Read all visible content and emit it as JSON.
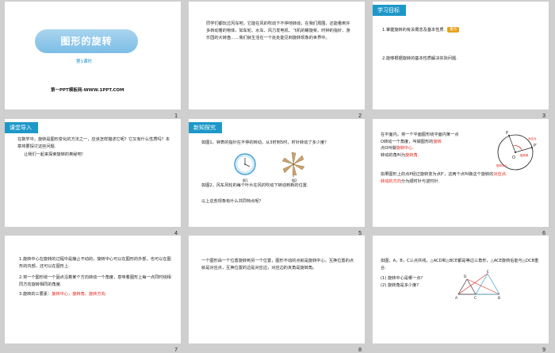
{
  "slides": [
    {
      "num": "1",
      "title": "图形的旋转",
      "subtitle": "第1课时",
      "brand": "第一PPT模板网-WWW.1PPT.COM"
    },
    {
      "num": "2",
      "text": "同学们都玩过风车吧，它能在风的吹动下不停地转动，在我们周围，还能看到许多转动着的物体，如车轮、水车、风力发电机、飞机的螺旋桨、时钟的指针、游乐园的大转盘……我们就生活在一个处处能见到旋转现象的世界中。"
    },
    {
      "num": "3",
      "tag": "学习目标",
      "item1": "1.掌握旋转的有关概念及基本性质.",
      "badge": "重点",
      "item2": "2.能够根据旋转的基本性质解决实际问题."
    },
    {
      "num": "4",
      "tag": "课堂导入",
      "text1": "在数学中，旋转是图形变化的方法之一，应该怎样描述它呢？它又有什么性质吗？本章将要探讨这些问题.",
      "text2": "让我们一起来探索旋转的奥秘吧！"
    },
    {
      "num": "5",
      "tag": "新知探究",
      "q1": "如图1，钟表的指针在不停的转动，从3时到5时，时针转动了多少度？",
      "fig1": "图1",
      "fig2": "图2",
      "q2": "如图2，风车风轮的每个叶片在风的吹动下转动到新的位置.",
      "q3": "以上这些现象有什么共同特点呢？"
    },
    {
      "num": "6",
      "l1": "在平面内，将一个平面图形绕平面内某一点",
      "l2": "O转动一个角度，叫做图形的",
      "l2r": "旋转.",
      "l3": "点O叫做",
      "l3r": "旋转中心.",
      "l4": "转动的角叫为",
      "l4r": "旋转角.",
      "l5": "如果图形上的点P经过旋转变为点P′，这两个点叫做这个旋转的",
      "l5r": "对应点.",
      "l6r": "转动的方向",
      "l6": "分为顺时针与逆时针.",
      "labP": "P",
      "labP2": "P′",
      "labO": "O",
      "labAng": "旋转角",
      "labCenter": "旋转中心",
      "labCorr": "对应点"
    },
    {
      "num": "7",
      "p1": "1.旋转中心在旋转的过程中是静止不动的，旋转中心可以在图形的外部，也可以在图形的内部，还可以在图形上.",
      "p2": "2.将一个图形绕一个固点沿着某个方向转动一个角度，意味着图形上每一点同时绕相同方向旋转相同的角度.",
      "p3a": "3.旋转的三要素：",
      "p3b": "旋转中心，旋转角，旋转方向."
    },
    {
      "num": "8",
      "text": "一个图形由一个位置旋转到另一个位置，图形不动的点就是旋转中心，互换位置的点就是对应点，互换位置的边是对应边，对应边的夹角是旋转角。"
    },
    {
      "num": "9",
      "s1": "如图，A，B，C三点共线，△ACD和△BCE都是等边三角形，△ACE旋转后能与△DCB重合.",
      "s2": "(1) 旋转中心是哪一点?",
      "s3": "(2) 旋转角是多少度?",
      "labA": "A",
      "labB": "B",
      "labC": "C",
      "labD": "D",
      "labE": "E"
    }
  ],
  "colors": {
    "accent": "#1e98c9",
    "red": "#e0241b",
    "badge": "#e8a21a",
    "bg": "#cfcfcf"
  }
}
